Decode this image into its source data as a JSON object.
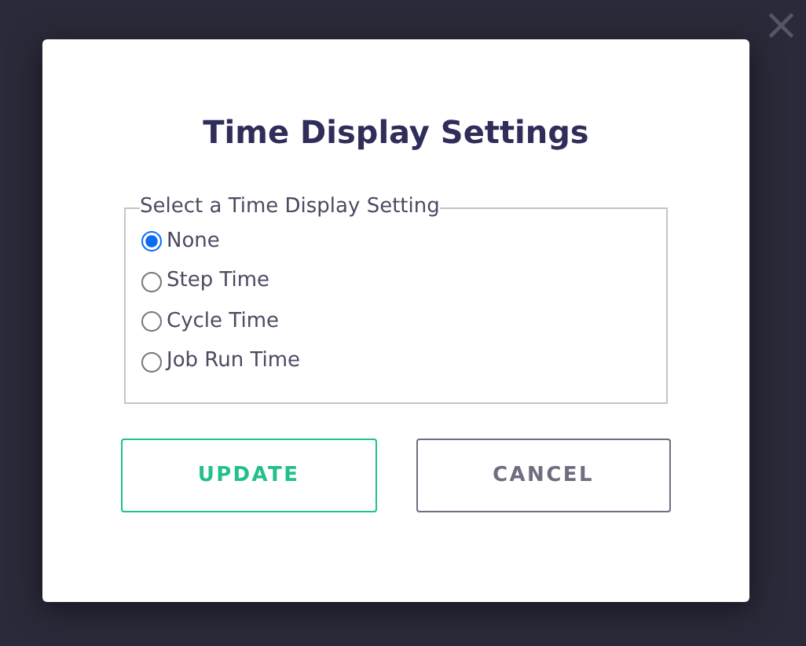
{
  "close": {
    "label": "×"
  },
  "dialog": {
    "title": "Time Display Settings",
    "group": {
      "legend": "Select a Time Display Setting",
      "options": [
        {
          "label": "None",
          "selected": true
        },
        {
          "label": "Step Time",
          "selected": false
        },
        {
          "label": "Cycle Time",
          "selected": false
        },
        {
          "label": "Job Run Time",
          "selected": false
        }
      ]
    },
    "buttons": [
      {
        "label": "UPDATE",
        "kind": "primary"
      },
      {
        "label": "CANCEL",
        "kind": "secondary"
      }
    ]
  }
}
